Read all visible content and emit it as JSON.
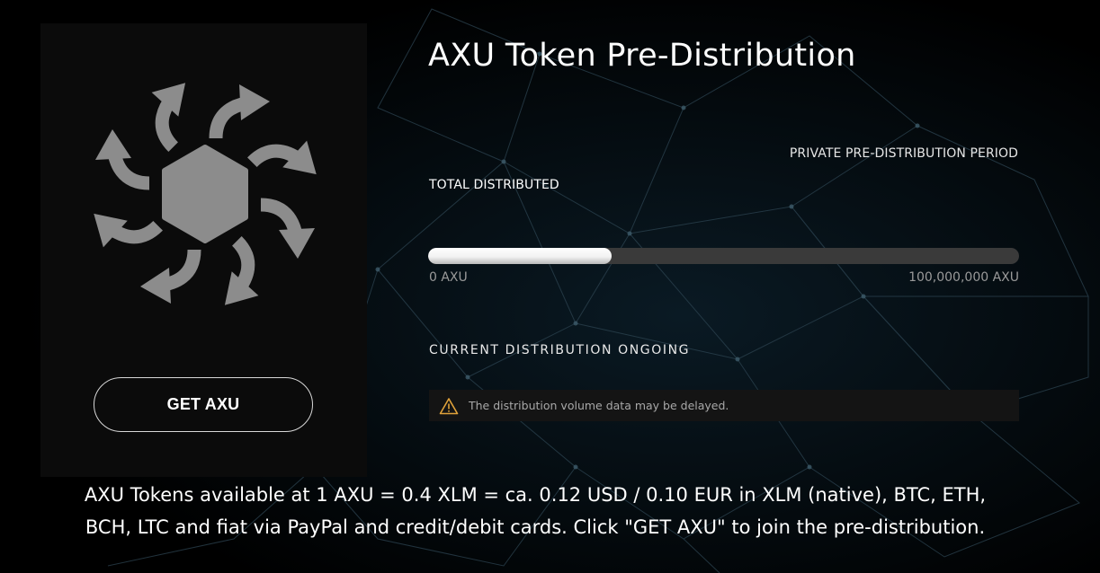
{
  "colors": {
    "background": "#000000",
    "card": "#0b0b0b",
    "logo": "#8c8c8c",
    "progress_track": "#3a3a3a",
    "progress_fill": "#ffffff",
    "warning": "#e0a23a"
  },
  "logo": {
    "icon": "axu-hexagon-arrows-logo"
  },
  "cta": {
    "label": "GET AXU"
  },
  "header": {
    "title": "AXU Token Pre-Distribution"
  },
  "distribution": {
    "period_label": "PRIVATE PRE-DISTRIBUTION PERIOD",
    "total_label": "TOTAL DISTRIBUTED",
    "progress_fraction": 0.31,
    "min_label": "0 AXU",
    "max_label": "100,000,000 AXU",
    "status_label": "CURRENT DISTRIBUTION ONGOING"
  },
  "notice": {
    "icon": "warning-triangle-icon",
    "text": "The distribution volume data may be delayed."
  },
  "footer": {
    "line1": "AXU Tokens available at 1 AXU = 0.4 XLM = ca. 0.12 USD / 0.10 EUR in XLM (native), BTC, ETH,",
    "line2": "BCH, LTC and fiat via PayPal and credit/debit cards. Click \"GET AXU\" to join the pre-distribution."
  }
}
